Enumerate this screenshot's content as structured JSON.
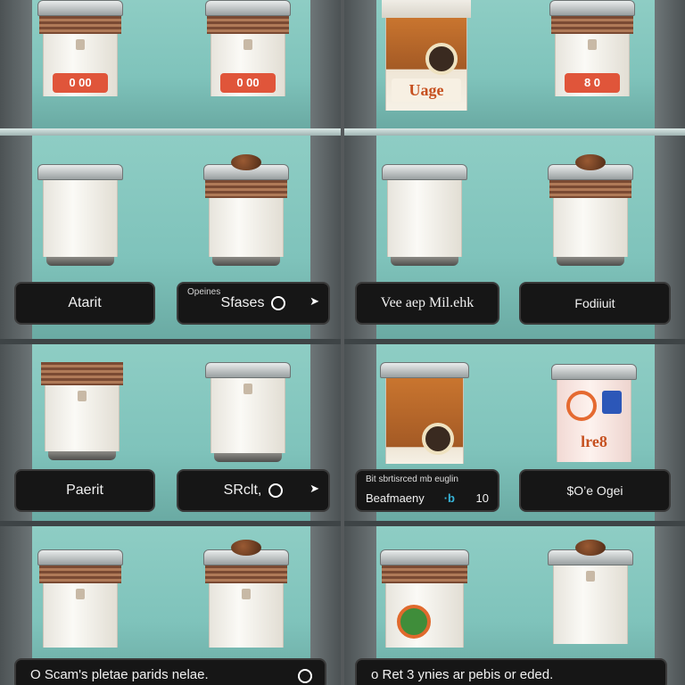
{
  "rows": {
    "r1": {
      "c1": {
        "price_a": "0 00",
        "price_b": "0 00"
      },
      "c2": {
        "sticker": "Uage",
        "price": "8 0"
      }
    },
    "r2": {
      "c1": {
        "label_a": "Atarit",
        "label_b_sub": "Opeines",
        "label_b": "Sfases"
      },
      "c2": {
        "label_a": "Vee aep Mil.ehk",
        "label_b": "Fodiiuit"
      }
    },
    "r3": {
      "c1": {
        "label_a": "Paerit",
        "label_b": "SRclt,"
      },
      "c2": {
        "label_a_top": "Bit sbrtisrced mb euglin",
        "label_a_main": "Beafmaeny",
        "label_a_accent": "·b",
        "label_a_num": "10",
        "sticker": "lre8",
        "label_b": "$O’e Ogei"
      }
    }
  },
  "footer": {
    "left": "O Scam's pletae parids nelae.",
    "right": "o Ret 3 ynies ar pebis or eded."
  },
  "icons": [
    "chevron-right-icon",
    "circle-icon"
  ]
}
